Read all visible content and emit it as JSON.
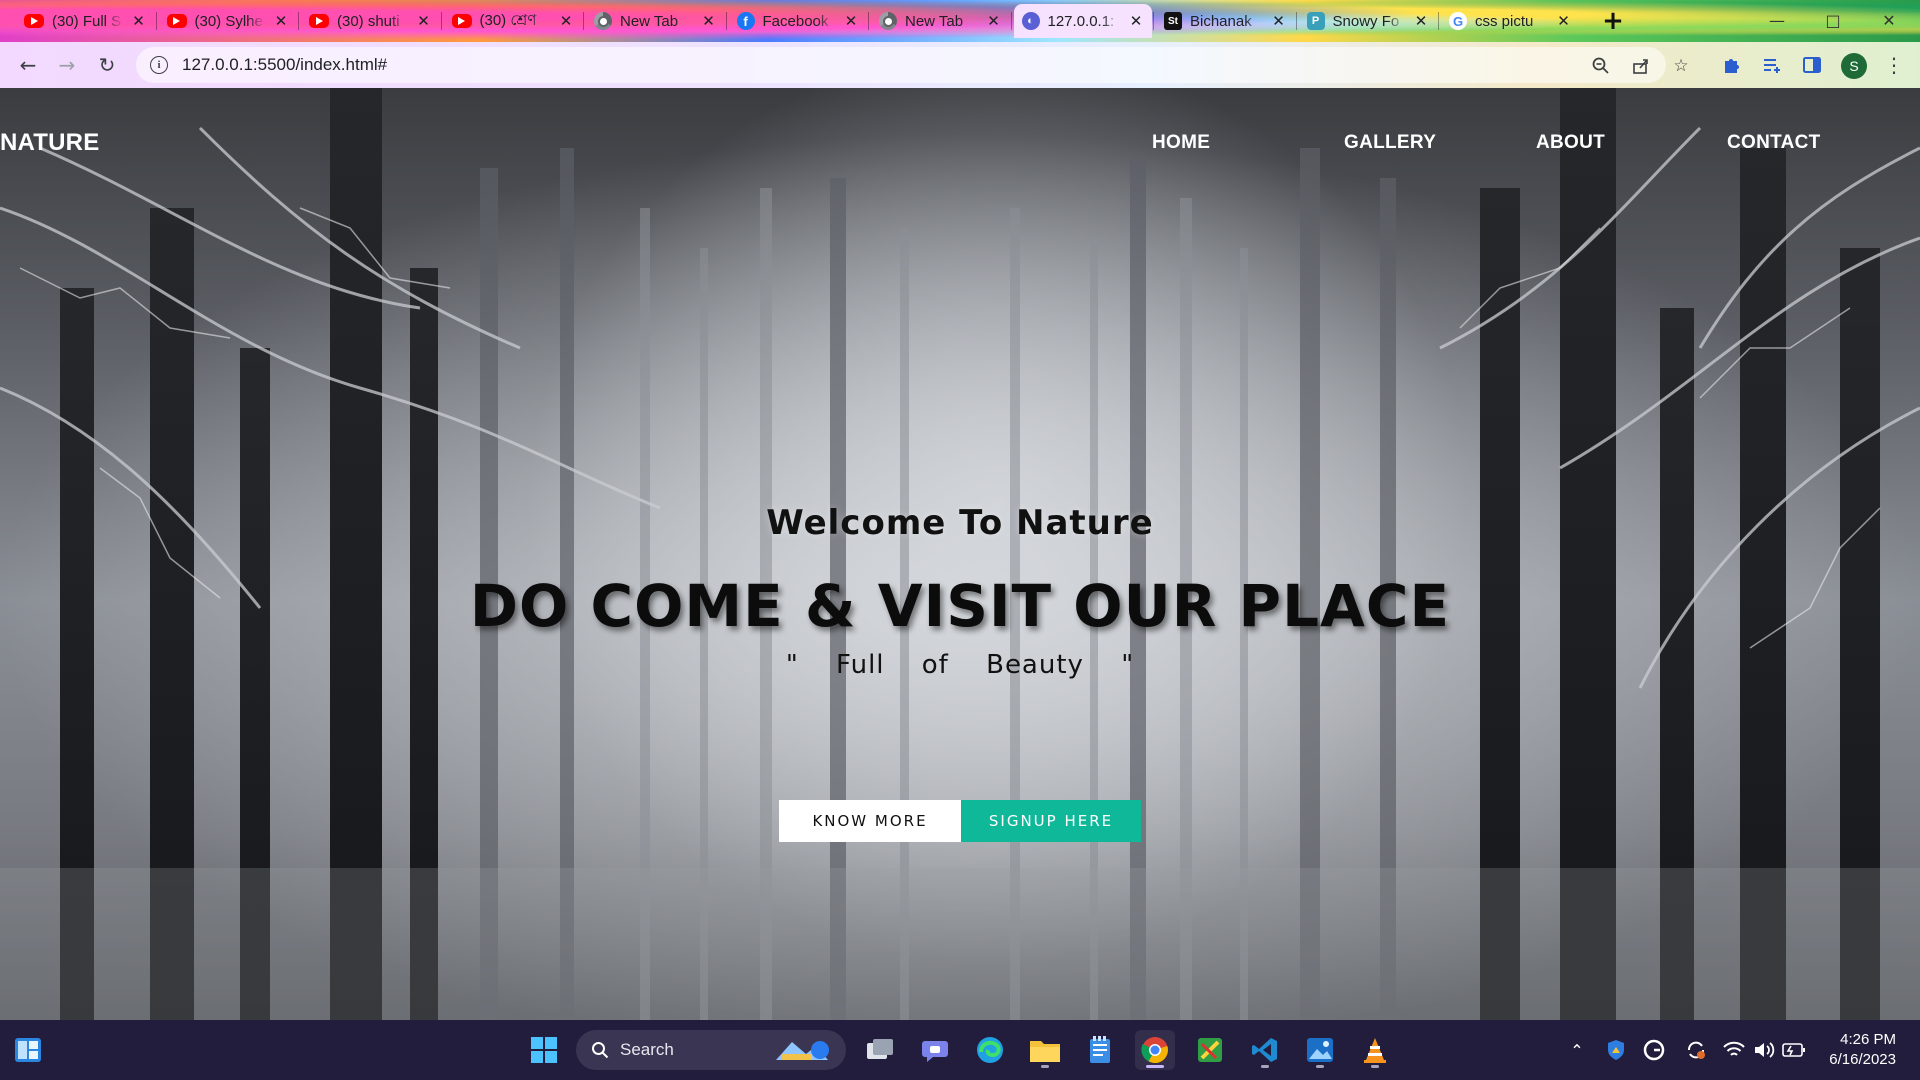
{
  "browser": {
    "tabs": [
      {
        "title": "(30) Full S",
        "icon": "youtube-icon",
        "active": false
      },
      {
        "title": "(30) Sylhe",
        "icon": "youtube-icon",
        "active": false
      },
      {
        "title": "(30) shuti",
        "icon": "youtube-icon",
        "active": false
      },
      {
        "title": "(30) শ্রেণ",
        "icon": "youtube-icon",
        "active": false
      },
      {
        "title": "New Tab",
        "icon": "chrome-icon",
        "active": false
      },
      {
        "title": "Facebook",
        "icon": "facebook-icon",
        "active": false
      },
      {
        "title": "New Tab",
        "icon": "chrome-icon",
        "active": false
      },
      {
        "title": "127.0.0.1:",
        "icon": "globe-icon",
        "active": true
      },
      {
        "title": "Bichanak",
        "icon": "sb-icon",
        "active": false
      },
      {
        "title": "Snowy Fo",
        "icon": "p-icon",
        "active": false
      },
      {
        "title": "css pictu",
        "icon": "google-icon",
        "active": false
      }
    ],
    "new_tab_symbol": "+",
    "url": "127.0.0.1:5500/index.html#",
    "profile_initial": "S"
  },
  "site": {
    "logo": "NATURE",
    "nav": {
      "home": "HOME",
      "gallery": "GALLERY",
      "about": "ABOUT",
      "contact": "CONTACT"
    },
    "hero": {
      "welcome": "Welcome To Nature",
      "headline": "DO COME & VISIT OUR PLACE",
      "tagline": "\" Full of Beauty \"",
      "know_more": "KNOW MORE",
      "signup": "SIGNUP HERE"
    }
  },
  "taskbar": {
    "search_placeholder": "Search",
    "time": "4:26 PM",
    "date": "6/16/2023"
  },
  "colors": {
    "signup_button": "#10b89a",
    "taskbar": "#221d3c"
  }
}
